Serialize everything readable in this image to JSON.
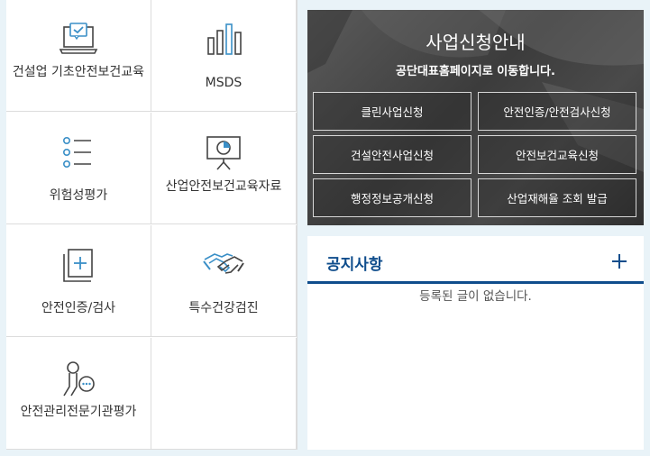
{
  "menu": [
    {
      "name": "construction-education",
      "label": "건설업 기초안전보건교육",
      "icon": "laptop-check-icon"
    },
    {
      "name": "msds",
      "label": "MSDS",
      "icon": "bar-chart-icon"
    },
    {
      "name": "risk-assessment",
      "label": "위험성평가",
      "icon": "list-icon"
    },
    {
      "name": "education-material",
      "label": "산업안전보건교육자료",
      "icon": "presentation-board-icon"
    },
    {
      "name": "safety-certification",
      "label": "안전인증/검사",
      "icon": "add-square-icon"
    },
    {
      "name": "special-health-checkup",
      "label": "특수건강검진",
      "icon": "handshake-icon"
    },
    {
      "name": "agency-evaluation",
      "label": "안전관리전문기관평가",
      "icon": "person-chat-icon"
    }
  ],
  "banner": {
    "title": "사업신청안내",
    "subtitle": "공단대표홈페이지로 이동합니다.",
    "buttons": [
      "클린사업신청",
      "안전인증/안전검사신청",
      "건설안전사업신청",
      "안전보건교육신청",
      "행정정보공개신청",
      "산업재해율 조회 발급"
    ]
  },
  "notice": {
    "title": "공지사항",
    "empty": "등록된 글이 없습니다."
  },
  "colors": {
    "accent": "#0f4d8c",
    "icon_blue": "#3a8fc7",
    "icon_dark": "#444444"
  }
}
